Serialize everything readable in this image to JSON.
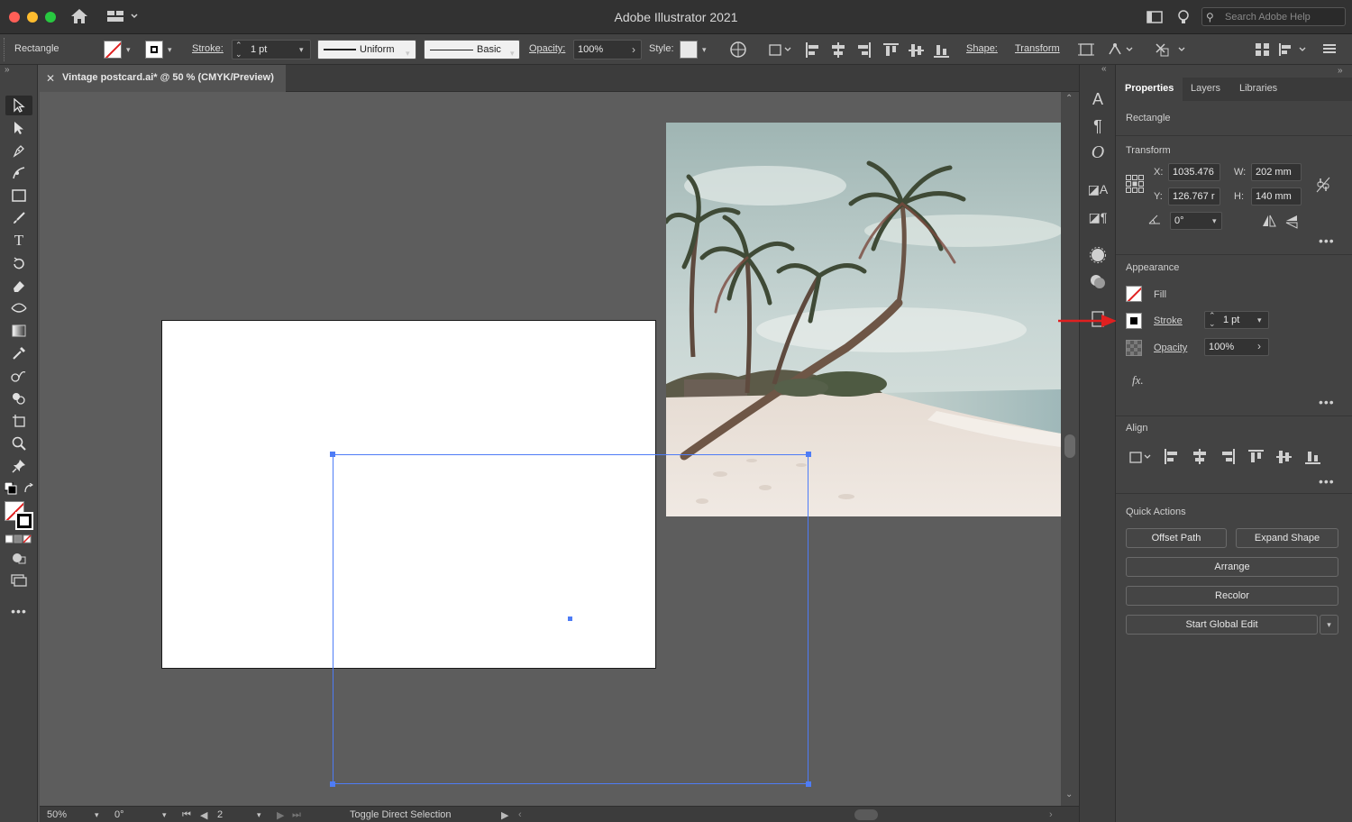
{
  "app": {
    "title": "Adobe Illustrator 2021",
    "search_placeholder": "Search Adobe Help"
  },
  "controlbar": {
    "object_type": "Rectangle",
    "stroke_label": "Stroke:",
    "stroke_value": "1 pt",
    "profile_value": "Uniform",
    "brush_value": "Basic",
    "opacity_label": "Opacity:",
    "opacity_value": "100%",
    "style_label": "Style:",
    "shape_label": "Shape:",
    "transform_label": "Transform"
  },
  "document": {
    "tab_title": "Vintage postcard.ai* @ 50 % (CMYK/Preview)"
  },
  "statusbar": {
    "zoom": "50%",
    "rotation": "0°",
    "artboard_number": "2",
    "status_text": "Toggle Direct Selection"
  },
  "panel": {
    "tabs": [
      "Properties",
      "Layers",
      "Libraries"
    ],
    "object_type": "Rectangle",
    "transform": {
      "section_title": "Transform",
      "x_label": "X:",
      "x_value": "1035.476",
      "y_label": "Y:",
      "y_value": "126.767 r",
      "w_label": "W:",
      "w_value": "202 mm",
      "h_label": "H:",
      "h_value": "140 mm",
      "angle_value": "0°"
    },
    "appearance": {
      "section_title": "Appearance",
      "fill_label": "Fill",
      "stroke_label": "Stroke",
      "stroke_value": "1 pt",
      "opacity_label": "Opacity",
      "opacity_value": "100%",
      "fx_label": "fx."
    },
    "align": {
      "section_title": "Align"
    },
    "quick_actions": {
      "section_title": "Quick Actions",
      "offset_path": "Offset Path",
      "expand_shape": "Expand Shape",
      "arrange": "Arrange",
      "recolor": "Recolor",
      "start_global_edit": "Start Global Edit"
    }
  },
  "colors": {
    "selection": "#4e7cf6",
    "annotation_arrow": "#e02020",
    "traffic_close": "#ff5f57",
    "traffic_min": "#febc2e",
    "traffic_max": "#28c840"
  }
}
